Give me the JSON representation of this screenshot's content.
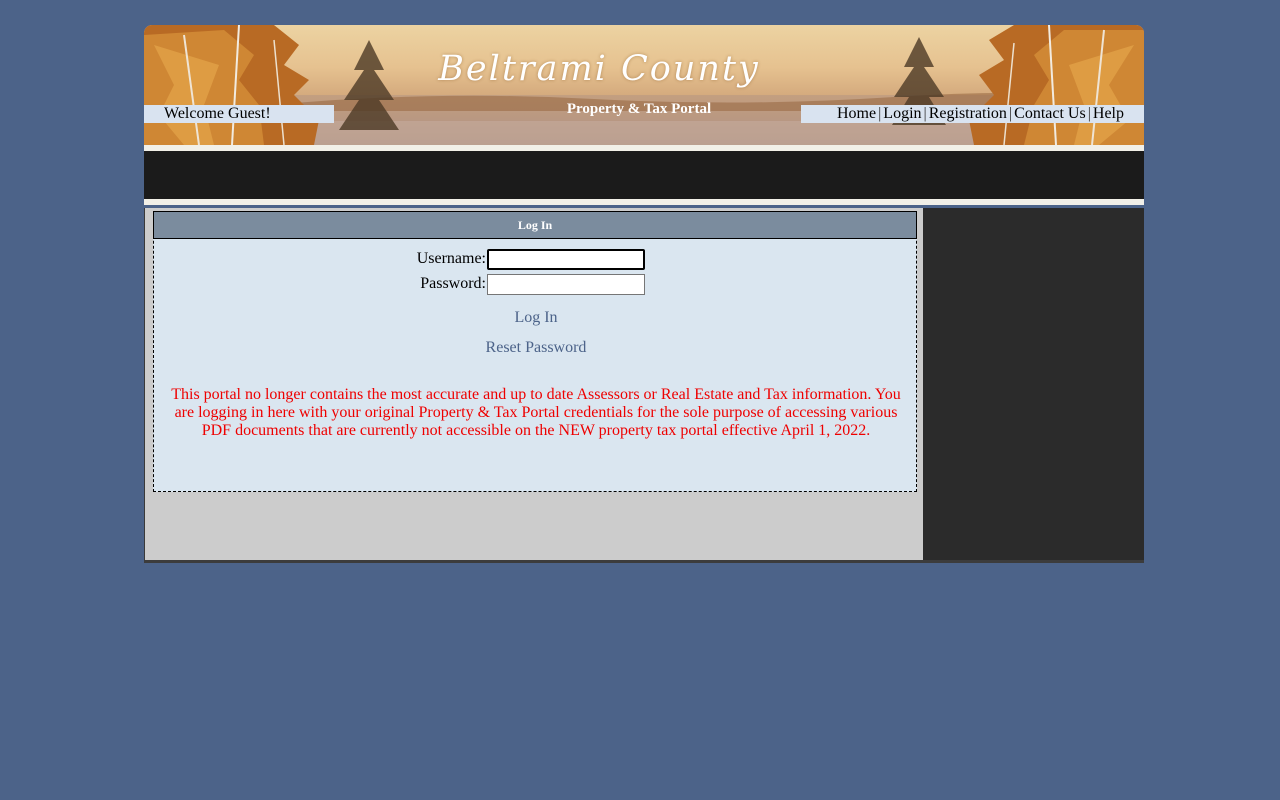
{
  "banner": {
    "title": "Beltrami County",
    "subtitle": "Property & Tax Portal",
    "welcome": "Welcome Guest!"
  },
  "nav": {
    "items": [
      {
        "label": "Home"
      },
      {
        "label": "Login"
      },
      {
        "label": "Registration"
      },
      {
        "label": "Contact Us"
      },
      {
        "label": "Help"
      }
    ],
    "separator": "|"
  },
  "login": {
    "header": "Log In",
    "username_label": "Username:",
    "username_value": "",
    "password_label": "Password:",
    "password_value": "",
    "login_link": "Log In",
    "reset_link": "Reset Password",
    "notice": "This portal no longer contains the most accurate and up to date Assessors or Real Estate and Tax information. You are logging in here with your original Property & Tax Portal credentials for the sole purpose of accessing various PDF documents that are currently not accessible on the NEW property tax portal effective April 1, 2022."
  },
  "colors": {
    "page_background": "#4c6389",
    "link": "#4c6389",
    "notice_text": "#ee0000",
    "header_bar": "#7b8c9e",
    "login_panel": "#dae6f0"
  }
}
